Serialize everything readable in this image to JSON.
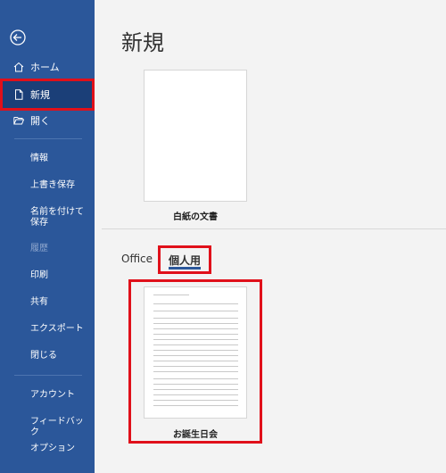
{
  "sidebar": {
    "home": "ホーム",
    "new": "新規",
    "open": "開く",
    "info": "情報",
    "save": "上書き保存",
    "save_as": "名前を付けて保存",
    "history": "履歴",
    "print": "印刷",
    "share": "共有",
    "export": "エクスポート",
    "close": "閉じる",
    "account": "アカウント",
    "feedback": "フィードバック",
    "options": "オプション"
  },
  "main": {
    "title": "新規",
    "blank_template": "白紙の文書",
    "tabs": [
      "Office",
      "個人用"
    ],
    "personal_template": "お誕生日会"
  },
  "colors": {
    "sidebar": "#2b579a",
    "selected": "#1b3f78",
    "highlight": "#e0101a"
  }
}
